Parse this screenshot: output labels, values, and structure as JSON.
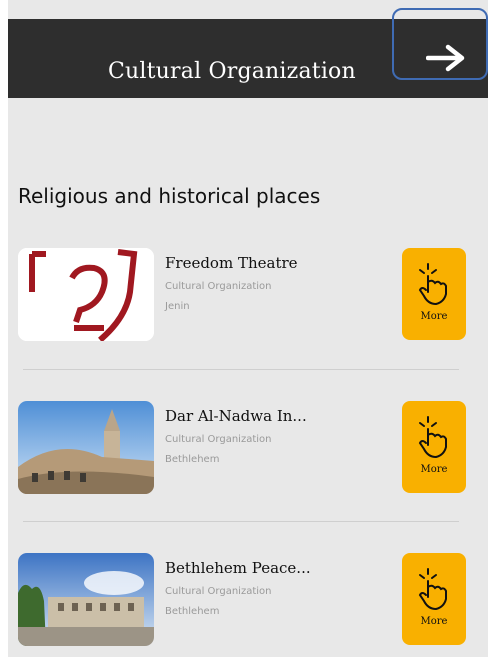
{
  "header": {
    "title": "Cultural Organization",
    "back_icon": "arrow-right-icon"
  },
  "section": {
    "title": "Religious and historical places"
  },
  "items": [
    {
      "name": "Freedom Theatre",
      "type": "Cultural Organization",
      "city": "Jenin",
      "more_label": "More",
      "thumb": "freedom-theatre-logo"
    },
    {
      "name": "Dar Al-Nadwa In...",
      "type": "Cultural Organization",
      "city": "Bethlehem",
      "more_label": "More",
      "thumb": "church-tower-photo"
    },
    {
      "name": "Bethlehem Peace...",
      "type": "Cultural Organization",
      "city": "Bethlehem",
      "more_label": "More",
      "thumb": "peace-center-photo"
    }
  ],
  "colors": {
    "header_bg": "#2e2e2e",
    "screen_bg": "#e8e8e8",
    "more_button": "#f9b000",
    "highlight_border": "#3f6bb3",
    "logo_red": "#a01820"
  }
}
